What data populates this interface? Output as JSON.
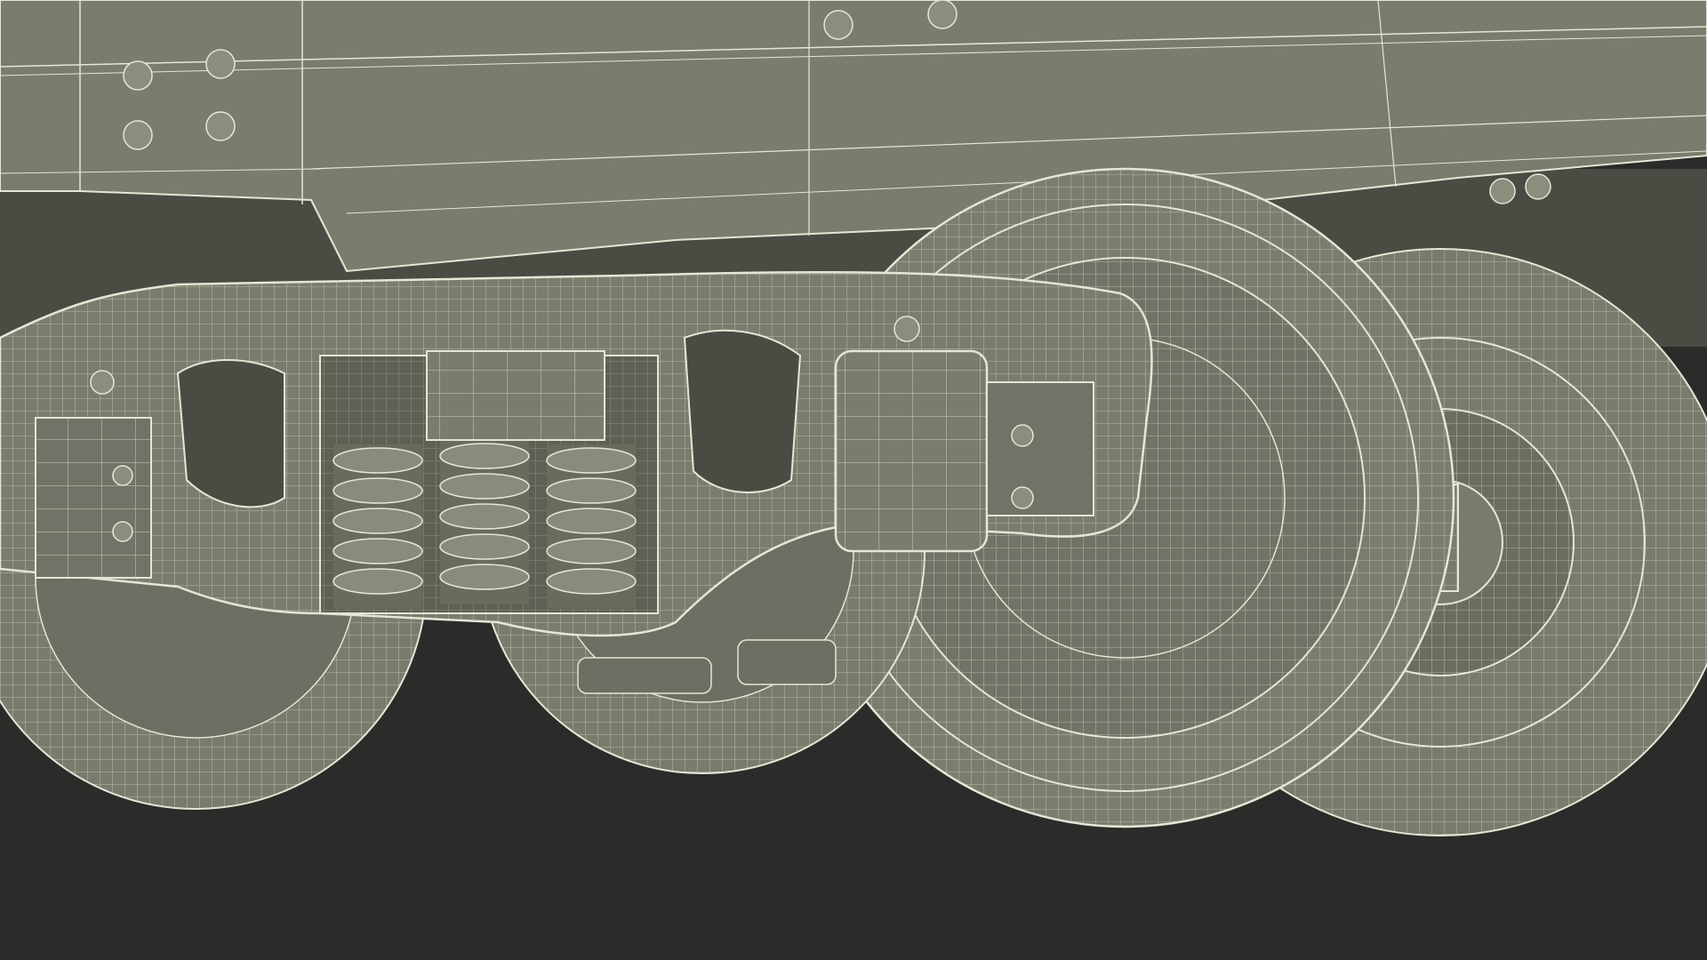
{
  "scene": {
    "subject": "wireframe-render",
    "colors": {
      "background": "#2b2b2a",
      "body_fill": "#7a7b6c",
      "body_dark": "#5f6054",
      "shadow_fill": "#4a4b42",
      "wire": "#e6e6d6",
      "wire_soft": "#c9cab8"
    }
  }
}
